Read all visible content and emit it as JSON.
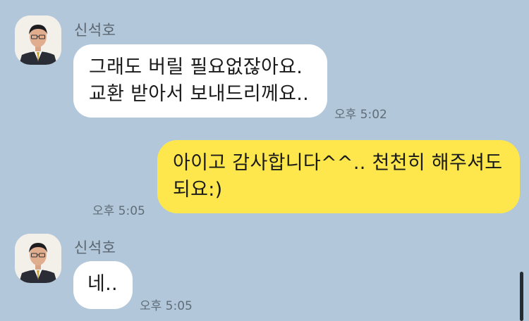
{
  "colors": {
    "background": "#b2c7d9",
    "incoming_bubble": "#ffffff",
    "outgoing_bubble": "#fde74c"
  },
  "messages": [
    {
      "sender": "신석호",
      "lines": [
        "그래도 버릴 필요없잖아요.",
        "교환 받아서 보내드리께요.."
      ],
      "time": "오후 5:02"
    },
    {
      "lines": [
        "아이고 감사합니다^^.. 천천히 해주셔도",
        "되요:)"
      ],
      "time": "오후 5:05"
    },
    {
      "sender": "신석호",
      "lines": [
        "네.."
      ],
      "time": "오후 5:05"
    }
  ]
}
